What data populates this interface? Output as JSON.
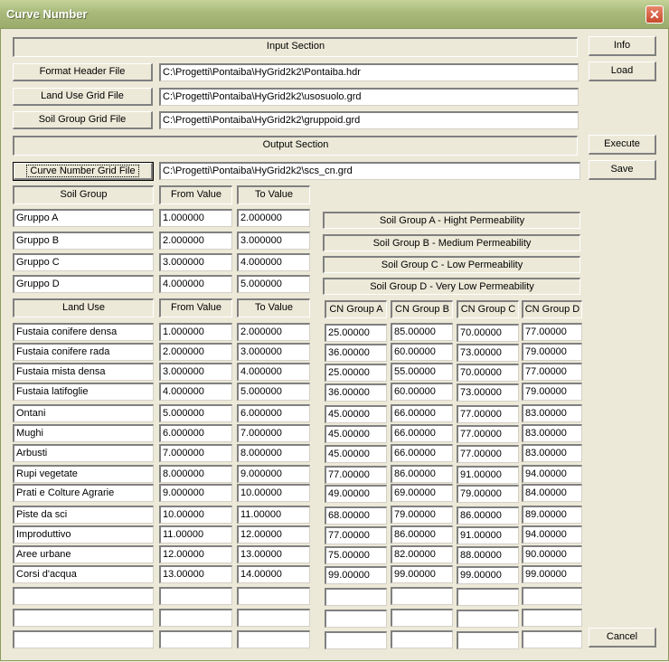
{
  "window": {
    "title": "Curve Number",
    "close_icon": "close-icon"
  },
  "input_section_label": "Input Section",
  "output_section_label": "Output Section",
  "buttons": {
    "info": "Info",
    "load": "Load",
    "execute": "Execute",
    "save": "Save",
    "cancel": "Cancel"
  },
  "files": {
    "format_header": {
      "label": "Format Header File",
      "value": "C:\\Progetti\\Pontaiba\\HyGrid2k2\\Pontaiba.hdr"
    },
    "land_use": {
      "label": "Land Use Grid File",
      "value": "C:\\Progetti\\Pontaiba\\HyGrid2k2\\usosuolo.grd"
    },
    "soil_group": {
      "label": "Soil Group Grid File",
      "value": "C:\\Progetti\\Pontaiba\\HyGrid2k2\\gruppoid.grd"
    },
    "curve_number": {
      "label": "Curve Number Grid File",
      "value": "C:\\Progetti\\Pontaiba\\HyGrid2k2\\scs_cn.grd"
    }
  },
  "soil_table": {
    "headers": [
      "Soil Group",
      "From Value",
      "To Value"
    ],
    "rows": [
      [
        "Gruppo A",
        "1.000000",
        "2.000000"
      ],
      [
        "Gruppo B",
        "2.000000",
        "3.000000"
      ],
      [
        "Gruppo C",
        "3.000000",
        "4.000000"
      ],
      [
        "Gruppo D",
        "4.000000",
        "5.000000"
      ]
    ],
    "descriptions": [
      "Soil Group A - Hight Permeability",
      "Soil Group B - Medium Permeability",
      "Soil Group C - Low Permeability",
      "Soil Group D - Very Low Permeability"
    ]
  },
  "land_table": {
    "headers": [
      "Land Use",
      "From Value",
      "To Value",
      "CN Group A",
      "CN Group B",
      "CN Group C",
      "CN Group D"
    ],
    "rows": [
      [
        "Fustaia conifere densa",
        "1.000000",
        "2.000000",
        "25.00000",
        "85.00000",
        "70.00000",
        "77.00000"
      ],
      [
        "Fustaia conifere rada",
        "2.000000",
        "3.000000",
        "36.00000",
        "60.00000",
        "73.00000",
        "79.00000"
      ],
      [
        "Fustaia mista densa",
        "3.000000",
        "4.000000",
        "25.00000",
        "55.00000",
        "70.00000",
        "77.00000"
      ],
      [
        "Fustaia latifoglie",
        "4.000000",
        "5.000000",
        "36.00000",
        "60.00000",
        "73.00000",
        "79.00000"
      ],
      [
        "Ontani",
        "5.000000",
        "6.000000",
        "45.00000",
        "66.00000",
        "77.00000",
        "83.00000"
      ],
      [
        "Mughi",
        "6.000000",
        "7.000000",
        "45.00000",
        "66.00000",
        "77.00000",
        "83.00000"
      ],
      [
        "Arbusti",
        "7.000000",
        "8.000000",
        "45.00000",
        "66.00000",
        "77.00000",
        "83.00000"
      ],
      [
        "Rupi vegetate",
        "8.000000",
        "9.000000",
        "77.00000",
        "86.00000",
        "91.00000",
        "94.00000"
      ],
      [
        "Prati e Colture Agrarie",
        "9.000000",
        "10.00000",
        "49.00000",
        "69.00000",
        "79.00000",
        "84.00000"
      ],
      [
        "Piste da sci",
        "10.00000",
        "11.00000",
        "68.00000",
        "79.00000",
        "86.00000",
        "89.00000"
      ],
      [
        "Improduttivo",
        "11.00000",
        "12.00000",
        "77.00000",
        "86.00000",
        "91.00000",
        "94.00000"
      ],
      [
        "Aree urbane",
        "12.00000",
        "13.00000",
        "75.00000",
        "82.00000",
        "88.00000",
        "90.00000"
      ],
      [
        "Corsi d'acqua",
        "13.00000",
        "14.00000",
        "99.00000",
        "99.00000",
        "99.00000",
        "99.00000"
      ],
      [
        "",
        "",
        "",
        "",
        "",
        "",
        ""
      ],
      [
        "",
        "",
        "",
        "",
        "",
        "",
        ""
      ],
      [
        "",
        "",
        "",
        "",
        "",
        "",
        ""
      ]
    ]
  }
}
